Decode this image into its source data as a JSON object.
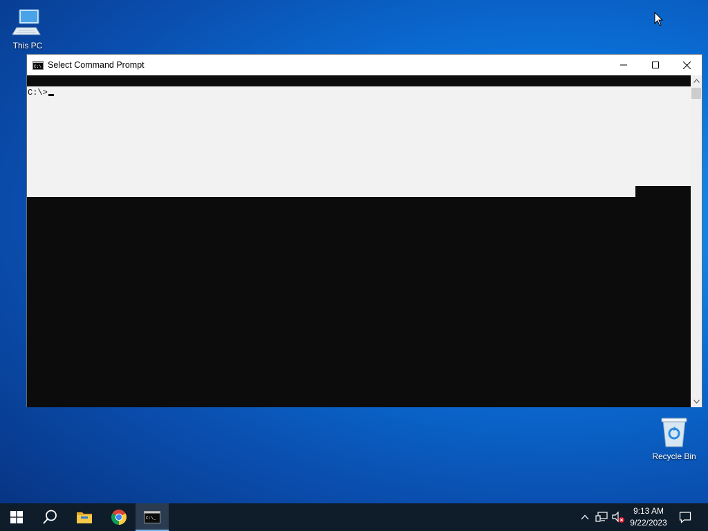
{
  "desktop": {
    "icons": [
      {
        "label": "This PC"
      },
      {
        "label": "Recycle Bin"
      }
    ]
  },
  "window": {
    "title": "Select Command Prompt",
    "console": {
      "prompt": "C:\\>"
    }
  },
  "taskbar": {
    "items": [
      "start",
      "search",
      "file-explorer",
      "chrome",
      "command-prompt"
    ],
    "active": "command-prompt",
    "clock": {
      "time": "9:13 AM",
      "date": "9/22/2023"
    }
  },
  "colors": {
    "console_bg": "#0c0c0c",
    "selection_bg": "#f2f2f2",
    "taskbar_bg": "#0f1c2a",
    "accent": "#76b9ed"
  }
}
